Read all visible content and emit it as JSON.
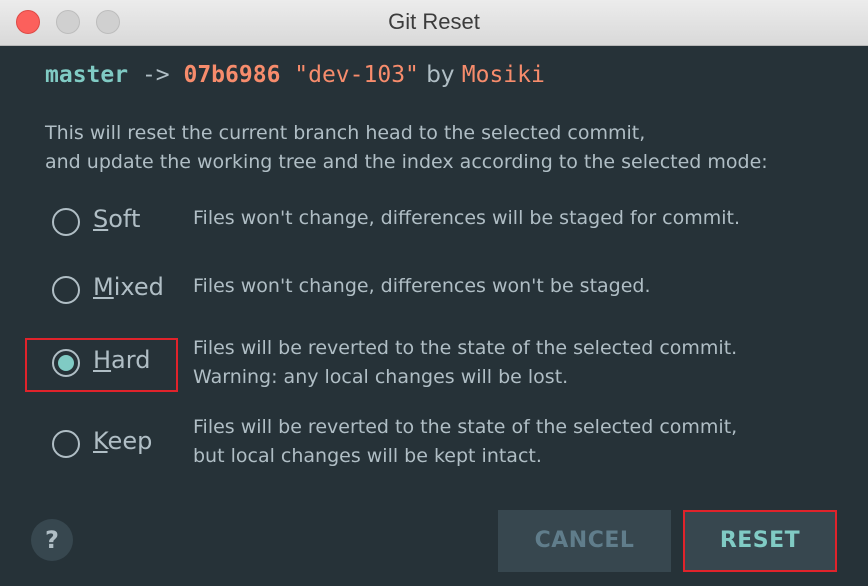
{
  "window": {
    "title": "Git Reset"
  },
  "header": {
    "branch": "master",
    "arrow": " -> ",
    "hash": "07b6986",
    "message": " \"dev-103\"",
    "by": " by ",
    "author": "Mosiki"
  },
  "description": {
    "line1": "This will reset the current branch head to the selected commit,",
    "line2": "and update the working tree and the index according to the selected mode:"
  },
  "options": [
    {
      "mnemonic": "S",
      "rest": "oft",
      "desc_line1": "Files won't change, differences will be staged for commit.",
      "desc_line2": "",
      "checked": false
    },
    {
      "mnemonic": "M",
      "rest": "ixed",
      "desc_line1": "Files won't change, differences won't be staged.",
      "desc_line2": "",
      "checked": false
    },
    {
      "mnemonic": "H",
      "rest": "ard",
      "desc_line1": "Files will be reverted to the state of the selected commit.",
      "desc_line2": "Warning: any local changes will be lost.",
      "checked": true
    },
    {
      "mnemonic": "K",
      "rest": "eep",
      "desc_line1": "Files will be reverted to the state of the selected commit,",
      "desc_line2": "but local changes will be kept intact.",
      "checked": false
    }
  ],
  "help": {
    "label": "?"
  },
  "buttons": {
    "cancel": "CANCEL",
    "reset": "RESET"
  },
  "colors": {
    "background": "#263238",
    "accent": "#80cbc4",
    "highlight": "#f78c6c",
    "text": "#b0bec5",
    "annotation_box": "#e0232b"
  },
  "icons": {
    "close": "close-icon",
    "minimize": "minimize-icon",
    "maximize": "maximize-icon",
    "help": "help-icon"
  }
}
